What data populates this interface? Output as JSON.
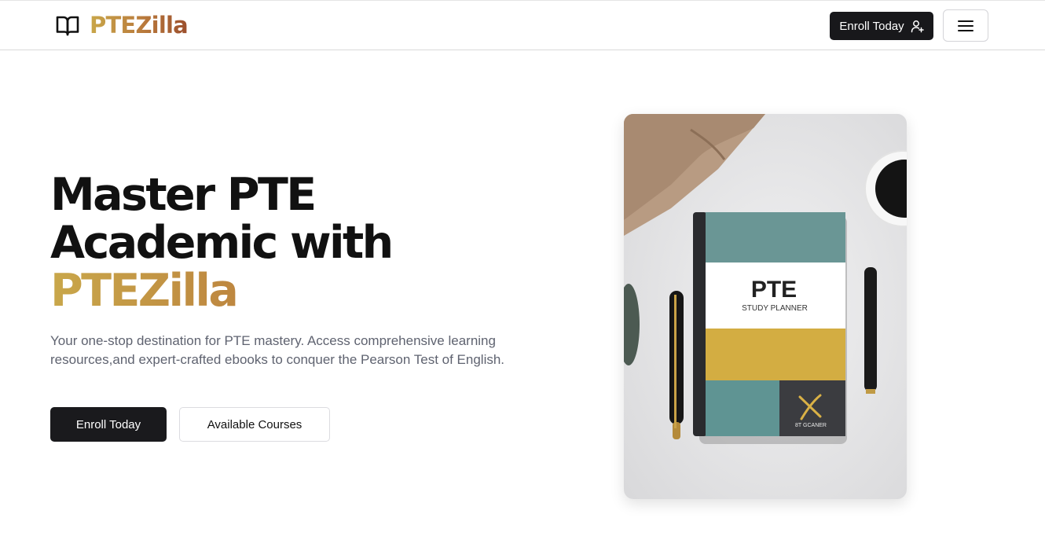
{
  "header": {
    "brand_name": "PTEZilla",
    "logo_icon": "open-book-icon",
    "enroll_label": "Enroll Today",
    "enroll_icon": "user-plus-icon",
    "menu_icon": "hamburger-menu-icon"
  },
  "hero": {
    "title_line1": "Master PTE",
    "title_line2": "Academic with",
    "title_brand": "PTEZilla",
    "description": "Your one-stop destination for PTE mastery. Access comprehensive learning resources,and expert-crafted ebooks to conquer the Pearson Test of English.",
    "primary_button": "Enroll Today",
    "secondary_button": "Available Courses"
  },
  "hero_image": {
    "book_title": "PTE",
    "book_subtitle": "STUDY PLANNER",
    "book_corner_text": "8T GCANER"
  },
  "colors": {
    "brand_gold": "#c9a74a",
    "brand_rust": "#9c4f2d",
    "primary_dark": "#18181b",
    "book_teal": "#6a9695",
    "book_mustard": "#d3ad42"
  }
}
